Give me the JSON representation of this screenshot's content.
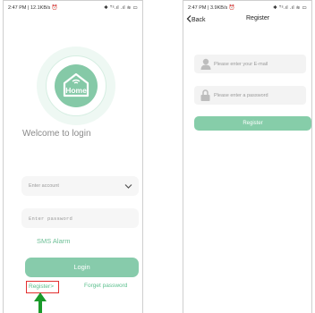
{
  "login_screen": {
    "status_bar": {
      "time": "2:47 PM | 12.1KB/s ⏰",
      "icons": "✱ ᵀˢ.ıl .ıl ≋ ▭"
    },
    "logo_text": "Home",
    "welcome": "Welcome to login",
    "account_placeholder": "Enter account",
    "password_placeholder": "Enter password",
    "sms_alarm": "SMS Alarm",
    "login_button": "Login",
    "register_link": "Register>",
    "forget_password": "Forget password"
  },
  "register_screen": {
    "status_bar": {
      "time": "2:47 PM | 3.9KB/s ⏰",
      "icons": "✱ ᵀˢ.ıl .ıl ≋ ▭"
    },
    "back": "Back",
    "title": "Register",
    "email_placeholder": "Please enter your E-mail",
    "password_placeholder": "Please enter a password",
    "register_button": "Register"
  },
  "colors": {
    "accent": "#87cbab",
    "link": "#5bbf8d",
    "highlight": "#e33030"
  }
}
